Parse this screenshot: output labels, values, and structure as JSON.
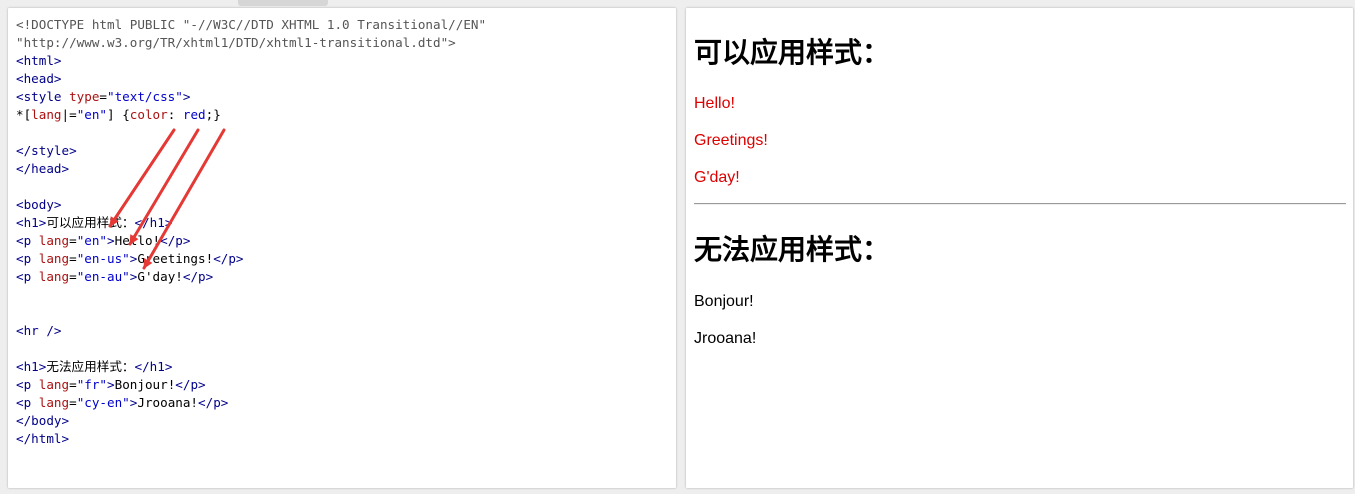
{
  "code_editor": {
    "lines": [
      [
        {
          "c": "pl",
          "t": "<!DOCTYPE html PUBLIC \"-//W3C//DTD XHTML 1.0 Transitional//EN\""
        }
      ],
      [
        {
          "c": "pl",
          "t": "\"http://www.w3.org/TR/xhtml1/DTD/xhtml1-transitional.dtd\">"
        }
      ],
      [
        {
          "c": "tg",
          "t": "<html>"
        }
      ],
      [
        {
          "c": "tg",
          "t": "<head>"
        }
      ],
      [
        {
          "c": "tg",
          "t": "<style "
        },
        {
          "c": "at",
          "t": "type"
        },
        {
          "c": "tx",
          "t": "="
        },
        {
          "c": "vl",
          "t": "\"text/css\""
        },
        {
          "c": "tg",
          "t": ">"
        }
      ],
      [
        {
          "c": "tx",
          "t": "*["
        },
        {
          "c": "at",
          "t": "lang"
        },
        {
          "c": "tx",
          "t": "|="
        },
        {
          "c": "vl",
          "t": "\"en\""
        },
        {
          "c": "tx",
          "t": "] {"
        },
        {
          "c": "at",
          "t": "color"
        },
        {
          "c": "tx",
          "t": ": "
        },
        {
          "c": "vl",
          "t": "red"
        },
        {
          "c": "tx",
          "t": ";}"
        }
      ],
      [],
      [
        {
          "c": "tg",
          "t": "</style>"
        }
      ],
      [
        {
          "c": "tg",
          "t": "</head>"
        }
      ],
      [],
      [
        {
          "c": "tg",
          "t": "<body>"
        }
      ],
      [
        {
          "c": "tg",
          "t": "<h1>"
        },
        {
          "c": "tx",
          "t": "可以应用样式："
        },
        {
          "c": "tg",
          "t": "</h1>"
        }
      ],
      [
        {
          "c": "tg",
          "t": "<p "
        },
        {
          "c": "at",
          "t": "lang"
        },
        {
          "c": "tx",
          "t": "="
        },
        {
          "c": "vl",
          "t": "\"en\""
        },
        {
          "c": "tg",
          "t": ">"
        },
        {
          "c": "tx",
          "t": "Hello!"
        },
        {
          "c": "tg",
          "t": "</p>"
        }
      ],
      [
        {
          "c": "tg",
          "t": "<p "
        },
        {
          "c": "at",
          "t": "lang"
        },
        {
          "c": "tx",
          "t": "="
        },
        {
          "c": "vl",
          "t": "\"en-us\""
        },
        {
          "c": "tg",
          "t": ">"
        },
        {
          "c": "tx",
          "t": "Greetings!"
        },
        {
          "c": "tg",
          "t": "</p>"
        }
      ],
      [
        {
          "c": "tg",
          "t": "<p "
        },
        {
          "c": "at",
          "t": "lang"
        },
        {
          "c": "tx",
          "t": "="
        },
        {
          "c": "vl",
          "t": "\"en-au\""
        },
        {
          "c": "tg",
          "t": ">"
        },
        {
          "c": "tx",
          "t": "G'day!"
        },
        {
          "c": "tg",
          "t": "</p>"
        }
      ],
      [],
      [],
      [
        {
          "c": "tg",
          "t": "<hr />"
        }
      ],
      [],
      [
        {
          "c": "tg",
          "t": "<h1>"
        },
        {
          "c": "tx",
          "t": "无法应用样式："
        },
        {
          "c": "tg",
          "t": "</h1>"
        }
      ],
      [
        {
          "c": "tg",
          "t": "<p "
        },
        {
          "c": "at",
          "t": "lang"
        },
        {
          "c": "tx",
          "t": "="
        },
        {
          "c": "vl",
          "t": "\"fr\""
        },
        {
          "c": "tg",
          "t": ">"
        },
        {
          "c": "tx",
          "t": "Bonjour!"
        },
        {
          "c": "tg",
          "t": "</p>"
        }
      ],
      [
        {
          "c": "tg",
          "t": "<p "
        },
        {
          "c": "at",
          "t": "lang"
        },
        {
          "c": "tx",
          "t": "="
        },
        {
          "c": "vl",
          "t": "\"cy-en\""
        },
        {
          "c": "tg",
          "t": ">"
        },
        {
          "c": "tx",
          "t": "Jrooana!"
        },
        {
          "c": "tg",
          "t": "</p>"
        }
      ],
      [
        {
          "c": "tg",
          "t": "</body>"
        }
      ],
      [
        {
          "c": "tg",
          "t": "</html>"
        }
      ]
    ],
    "annotation_arrow_color": "#e53935"
  },
  "preview": {
    "heading_applies": "可以应用样式：",
    "p1": "Hello!",
    "p2": "Greetings!",
    "p3": "G'day!",
    "heading_not_applies": "无法应用样式：",
    "p4": "Bonjour!",
    "p5": "Jrooana!",
    "styled_color": "#dd0000"
  }
}
